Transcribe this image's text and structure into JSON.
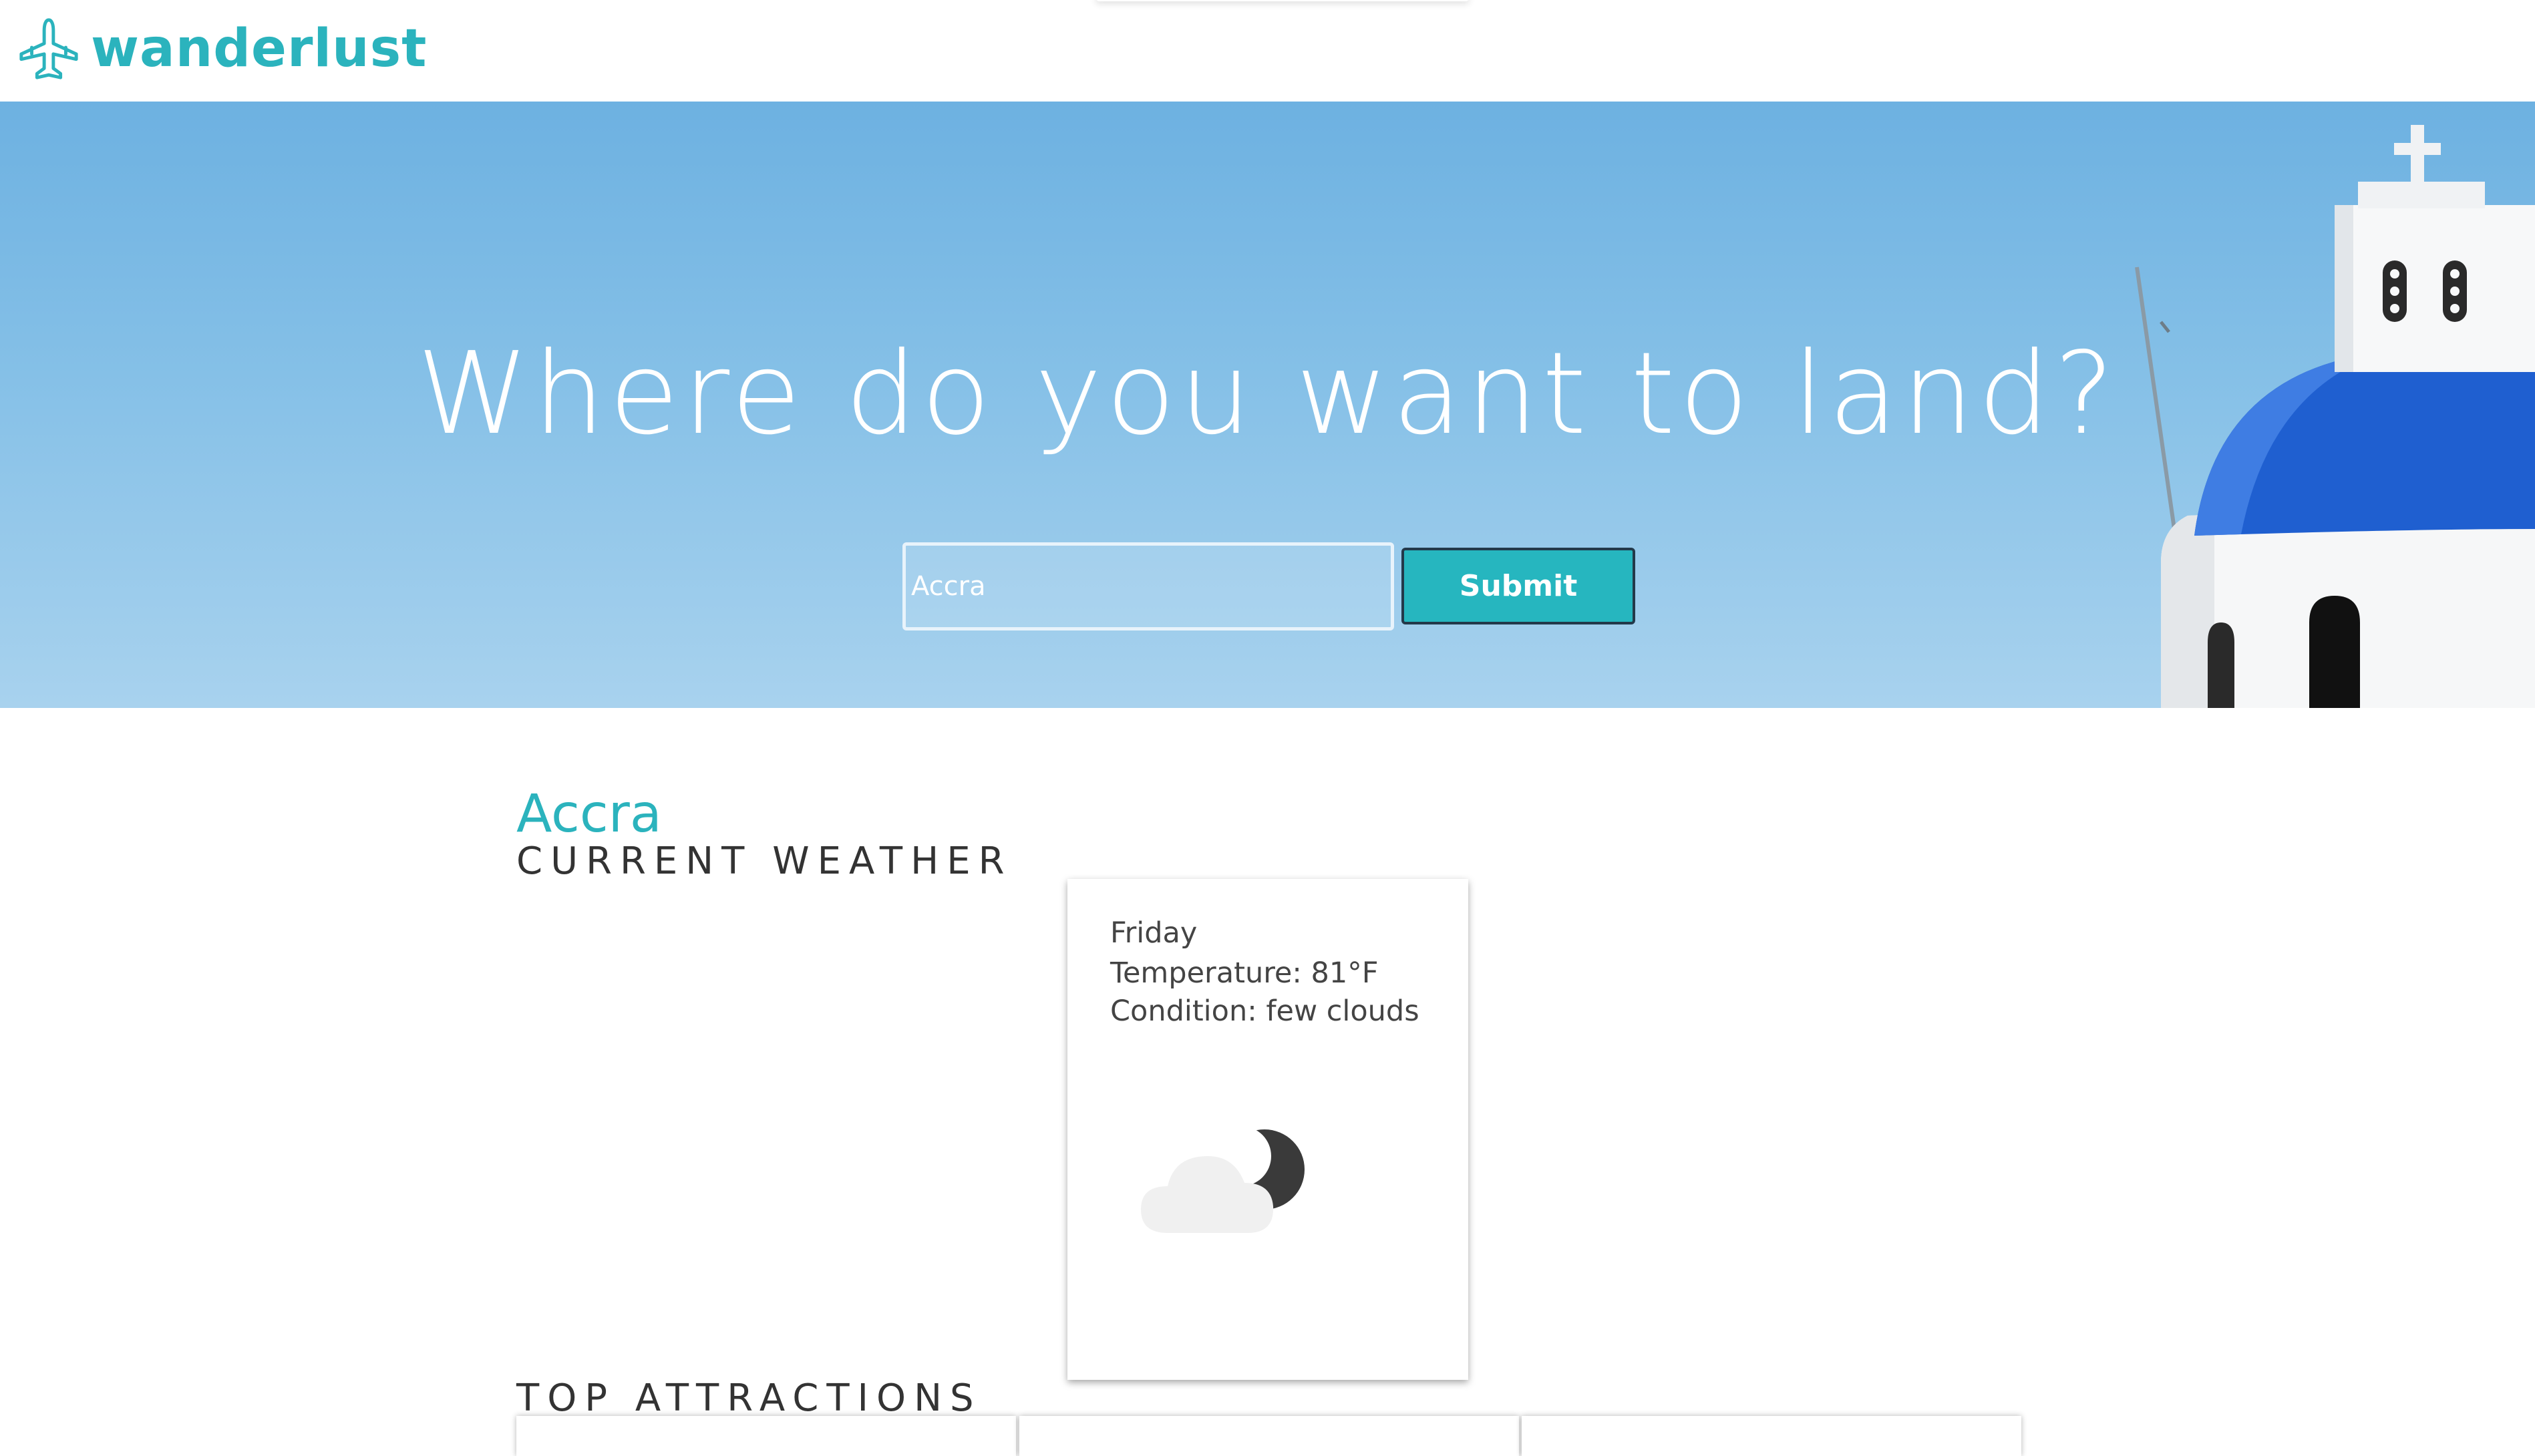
{
  "app": {
    "brand_name": "wanderlust",
    "brand_color": "#2bb3bd"
  },
  "hero": {
    "title": "Where do you want to land?",
    "search_value": "Accra",
    "submit_label": "Submit",
    "accent": "#26b6bf"
  },
  "results": {
    "city": "Accra",
    "current_weather_heading": "CURRENT WEATHER",
    "weather": {
      "day": "Friday",
      "temperature": "Temperature: 81°F",
      "condition": "Condition: few clouds",
      "icon": "few-clouds-night-icon"
    },
    "top_attractions_heading": "TOP ATTRACTIONS",
    "attraction_card_count": 3
  }
}
